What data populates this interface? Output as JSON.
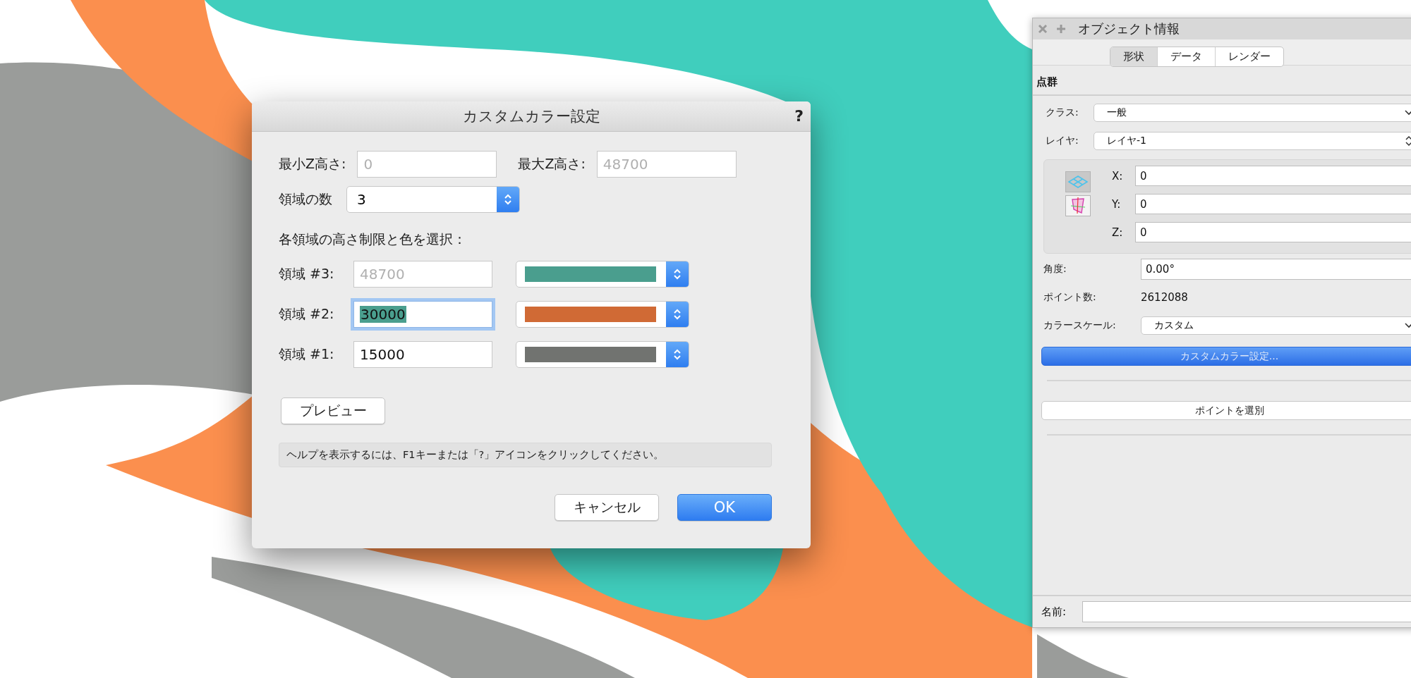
{
  "dialog": {
    "title": "カスタムカラー設定",
    "help": "?",
    "min_z": {
      "label": "最小Z高さ:",
      "value": "0",
      "disabled": true
    },
    "max_z": {
      "label": "最大Z高さ:",
      "value": "48700",
      "disabled": true
    },
    "region_count": {
      "label": "領域の数",
      "value": "3"
    },
    "instruction": "各領域の高さ制限と色を選択：",
    "regions": [
      {
        "label": "領域 #3:",
        "value": "48700",
        "disabled": true,
        "focused": false,
        "color": "#4a9e8e"
      },
      {
        "label": "領域 #2:",
        "value": "30000",
        "disabled": false,
        "focused": true,
        "color": "#d06a35"
      },
      {
        "label": "領域 #1:",
        "value": "15000",
        "disabled": false,
        "focused": false,
        "color": "#717370"
      }
    ],
    "preview_button": "プレビュー",
    "help_text": "ヘルプを表示するには、F1キーまたは「?」アイコンをクリックしてください。",
    "buttons": [
      {
        "label": "キャンセル",
        "default": false
      },
      {
        "label": "OK",
        "default": true
      }
    ]
  },
  "panel": {
    "title": "オブジェクト情報",
    "tabs": [
      {
        "label": "形状",
        "selected": true
      },
      {
        "label": "データ",
        "selected": false
      },
      {
        "label": "レンダー",
        "selected": false
      }
    ],
    "section": "点群",
    "class_field": {
      "label": "クラス:",
      "value": "一般"
    },
    "layer_field": {
      "label": "レイヤ:",
      "value": "レイヤ-1"
    },
    "plane_modes": [
      {
        "kind": "layer",
        "selected": true
      },
      {
        "kind": "screen",
        "selected": false
      }
    ],
    "coords": [
      {
        "label": "X:",
        "value": "0"
      },
      {
        "label": "Y:",
        "value": "0"
      },
      {
        "label": "Z:",
        "value": "0"
      }
    ],
    "angle": {
      "label": "角度:",
      "value": "0.00°"
    },
    "point_count": {
      "label": "ポイント数:",
      "value": "2612088"
    },
    "color_scale": {
      "label": "カラースケール:",
      "value": "カスタム"
    },
    "custom_color_button": "カスタムカラー設定...",
    "select_points_button": "ポイントを選別",
    "name_field": {
      "label": "名前:"
    }
  }
}
